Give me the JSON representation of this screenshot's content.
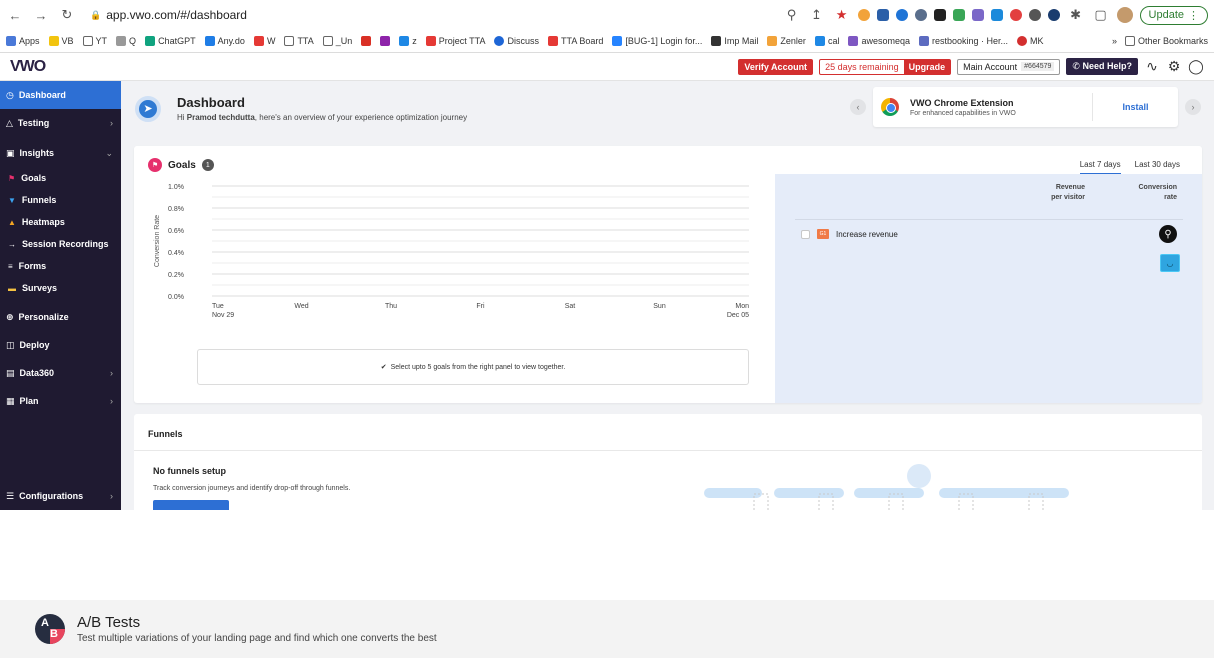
{
  "browser": {
    "url": "app.vwo.com/#/dashboard",
    "update_label": "Update",
    "bookmarks": [
      "Apps",
      "VB",
      "YT",
      "Q",
      "ChatGPT",
      "Any.do",
      "W",
      "TTA",
      "_Un",
      "z",
      "Project TTA",
      "Discuss",
      "TTA Board",
      "[BUG-1] Login for...",
      "Imp Mail",
      "Zenler",
      "cal",
      "awesomeqa",
      "restbooking · Her...",
      "MK"
    ],
    "other_bookmarks": "Other Bookmarks",
    "more_label": "»"
  },
  "topbar": {
    "logo": "VWO",
    "verify_label": "Verify Account",
    "trial_days": "25 days remaining",
    "upgrade_label": "Upgrade",
    "account_label": "Main Account",
    "account_id": "#664579",
    "help_label": "Need Help?"
  },
  "sidebar": {
    "dashboard": "Dashboard",
    "testing": "Testing",
    "insights": "Insights",
    "insights_sub": [
      "Goals",
      "Funnels",
      "Heatmaps",
      "Session Recordings",
      "Forms",
      "Surveys"
    ],
    "personalize": "Personalize",
    "deploy": "Deploy",
    "data360": "Data360",
    "plan": "Plan",
    "configurations": "Configurations"
  },
  "dashboard": {
    "title": "Dashboard",
    "subtitle_pre": "Hi ",
    "user": "Pramod techdutta",
    "subtitle_post": ", here's an overview of your experience optimization journey"
  },
  "extension": {
    "title": "VWO Chrome Extension",
    "subtitle": "For enhanced capabilities in VWO",
    "install_label": "Install"
  },
  "goals": {
    "title": "Goals",
    "count": "1",
    "tabs": [
      "Last 7 days",
      "Last 30 days"
    ],
    "note": "Select upto 5 goals from the right panel to view together.",
    "col_revenue_1": "Revenue",
    "col_revenue_2": "per visitor",
    "col_conv_1": "Conversion",
    "col_conv_2": "rate",
    "goal_badge": "G1",
    "goal_name": "Increase revenue"
  },
  "chart_data": {
    "type": "line",
    "ylabel": "Conversion Rate",
    "y_ticks": [
      "1.0%",
      "0.8%",
      "0.6%",
      "0.4%",
      "0.2%",
      "0.0%"
    ],
    "ylim": [
      0,
      1.0
    ],
    "x_ticks": [
      {
        "day": "Tue",
        "date": "Nov 29"
      },
      {
        "day": "Wed",
        "date": ""
      },
      {
        "day": "Thu",
        "date": ""
      },
      {
        "day": "Fri",
        "date": ""
      },
      {
        "day": "Sat",
        "date": ""
      },
      {
        "day": "Sun",
        "date": ""
      },
      {
        "day": "Mon",
        "date": "Dec 05"
      }
    ],
    "series": [],
    "grid": true
  },
  "funnels": {
    "title": "Funnels",
    "empty_title": "No funnels setup",
    "empty_sub": "Track conversion journeys and identify drop-off through funnels."
  },
  "ab": {
    "logo_a": "A",
    "logo_b": "B",
    "title": "A/B Tests",
    "subtitle": "Test multiple variations of your landing page and find which one converts the best"
  }
}
